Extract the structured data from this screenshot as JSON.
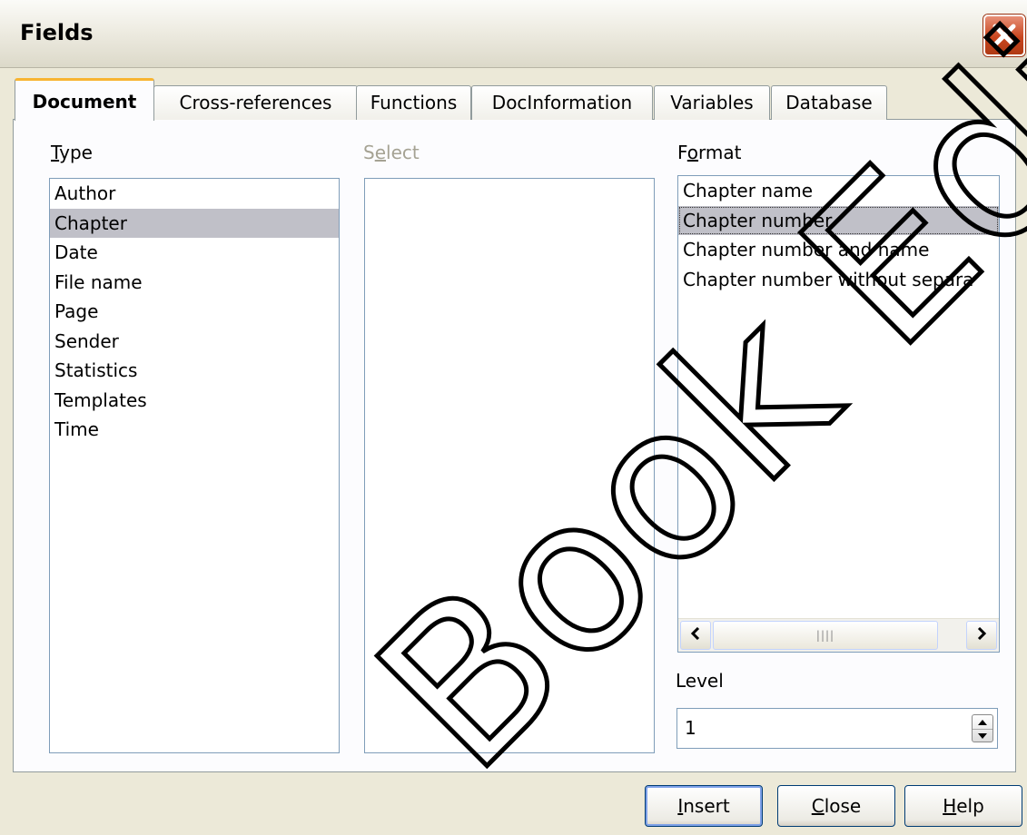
{
  "window": {
    "title": "Fields"
  },
  "tabs": [
    "Document",
    "Cross-references",
    "Functions",
    "DocInformation",
    "Variables",
    "Database"
  ],
  "type": {
    "label_access": "T",
    "label_rest": "ype",
    "items": [
      "Author",
      "Chapter",
      "Date",
      "File name",
      "Page",
      "Sender",
      "Statistics",
      "Templates",
      "Time"
    ],
    "selected": "Chapter"
  },
  "select": {
    "label_pre": "S",
    "label_access": "e",
    "label_rest": "lect"
  },
  "format": {
    "label_pre": "F",
    "label_access": "o",
    "label_rest": "rmat",
    "items": [
      "Chapter name",
      "Chapter number",
      "Chapter number and name",
      "Chapter number without separa"
    ],
    "selected": "Chapter number"
  },
  "level": {
    "label": "Level",
    "value": "1"
  },
  "buttons": {
    "insert_access": "I",
    "insert_rest": "nsert",
    "close_access": "C",
    "close_rest": "lose",
    "help_access": "H",
    "help_rest": "elp"
  },
  "icons": {
    "close": "close-icon",
    "scroll_left": "arrow-left-icon",
    "scroll_right": "arrow-right-icon",
    "spin": "spin-up-down-icon"
  },
  "colors": {
    "dialog_bg": "#ece9d8",
    "tab_accent": "#f8b431",
    "selection": "#c0c0c8",
    "close_red": "#c8461f"
  },
  "watermark": "Book Edition"
}
